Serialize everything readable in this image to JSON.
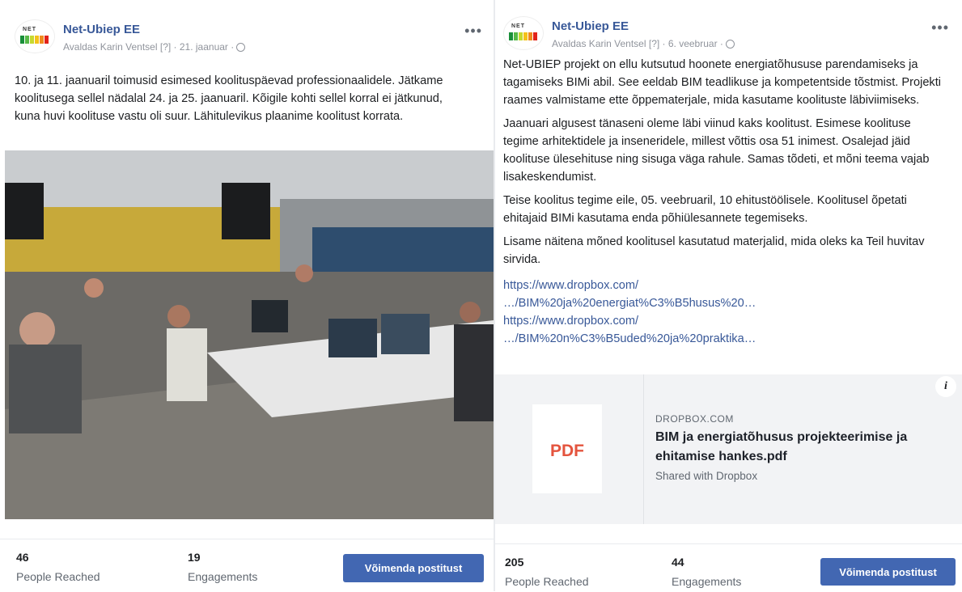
{
  "post1": {
    "page_name": "Net-Ubiep EE",
    "meta": "Avaldas Karin Ventsel [?] · 21. jaanuar ·",
    "more": "•••",
    "text": "10. ja 11. jaanuaril toimusid esimesed koolituspäevad professionaalidele. Jätkame koolitusega sellel nädalal 24. ja 25. jaanuaril. Kõigile kohti sellel korral ei jätkunud, kuna huvi koolituse vastu oli suur. Lähitulevikus plaanime koolitust korrata.",
    "stats": {
      "reached_num": "46",
      "reached_label": "People Reached",
      "engagements_num": "19",
      "engagements_label": "Engagements",
      "boost_label": "Võimenda postitust"
    }
  },
  "post2": {
    "page_name": "Net-Ubiep EE",
    "meta": "Avaldas Karin Ventsel [?] · 6. veebruar ·",
    "more": "•••",
    "paragraphs": [
      "Net-UBIEP projekt on ellu kutsutud hoonete energiatõhususe parendamiseks ja tagamiseks BIMi abil. See eeldab BIM teadlikuse ja kompetentside tõstmist. Projekti raames valmistame ette õppematerjale, mida kasutame koolituste läbiviimiseks.",
      "Jaanuari algusest tänaseni oleme läbi viinud kaks koolitust. Esimese koolituse tegime arhitektidele ja inseneridele, millest võttis osa 51 inimest. Osalejad jäid koolituse ülesehituse ning sisuga väga rahule. Samas tõdeti, et mõni teema vajab lisakeskendumist.",
      "Teise koolitus tegime eile, 05. veebruaril, 10 ehitustöölisele. Koolitusel õpetati ehitajaid BIMi kasutama enda põhiülesannete tegemiseks.",
      "Lisame näitena mõned koolitusel kasutatud materjalid, mida oleks ka Teil huvitav sirvida."
    ],
    "links": [
      "https://www.dropbox.com/",
      "…/BIM%20ja%20energiat%C3%B5husus%20…",
      "https://www.dropbox.com/",
      "…/BIM%20n%C3%B5uded%20ja%20praktika…"
    ],
    "card": {
      "thumb_label": "PDF",
      "domain": "DROPBOX.COM",
      "title": "BIM ja energiatõhusus projekteerimise ja ehitamise hankes.pdf",
      "subtitle": "Shared with Dropbox",
      "info": "i"
    },
    "stats": {
      "reached_num": "205",
      "reached_label": "People Reached",
      "engagements_num": "44",
      "engagements_label": "Engagements",
      "boost_label": "Võimenda postitust"
    }
  },
  "colors": {
    "accent": "#4267b2",
    "link": "#385898",
    "pdf": "#e4543e"
  },
  "icons": [
    "globe-icon",
    "more-icon",
    "info-icon",
    "page-logo"
  ]
}
